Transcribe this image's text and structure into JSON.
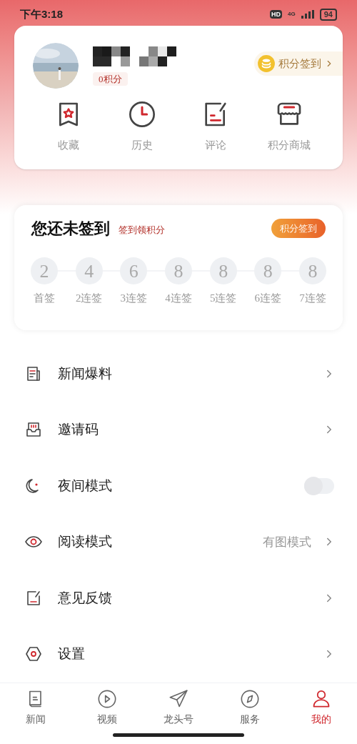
{
  "status_bar": {
    "time": "下午3:18",
    "hd": "HD",
    "network": "4G",
    "battery": "94"
  },
  "profile": {
    "points": "0积分",
    "checkin_button": "积分签到"
  },
  "shortcuts": [
    {
      "label": "收藏"
    },
    {
      "label": "历史"
    },
    {
      "label": "评论"
    },
    {
      "label": "积分商城"
    }
  ],
  "checkin": {
    "title": "您还未签到",
    "subtitle": "签到领积分",
    "button": "积分签到",
    "days": [
      {
        "points": "2",
        "label": "首签"
      },
      {
        "points": "4",
        "label": "2连签"
      },
      {
        "points": "6",
        "label": "3连签"
      },
      {
        "points": "8",
        "label": "4连签"
      },
      {
        "points": "8",
        "label": "5连签"
      },
      {
        "points": "8",
        "label": "6连签"
      },
      {
        "points": "8",
        "label": "7连签"
      }
    ]
  },
  "menu": [
    {
      "kind": "link",
      "label": "新闻爆料"
    },
    {
      "kind": "link",
      "label": "邀请码"
    },
    {
      "kind": "toggle",
      "label": "夜间模式",
      "on": false
    },
    {
      "kind": "link",
      "label": "阅读模式",
      "value": "有图模式"
    },
    {
      "kind": "link",
      "label": "意见反馈"
    },
    {
      "kind": "link",
      "label": "设置"
    }
  ],
  "tabs": [
    {
      "label": "新闻",
      "selected": false
    },
    {
      "label": "视频",
      "selected": false
    },
    {
      "label": "龙头号",
      "selected": false
    },
    {
      "label": "服务",
      "selected": false
    },
    {
      "label": "我的",
      "selected": true
    }
  ]
}
